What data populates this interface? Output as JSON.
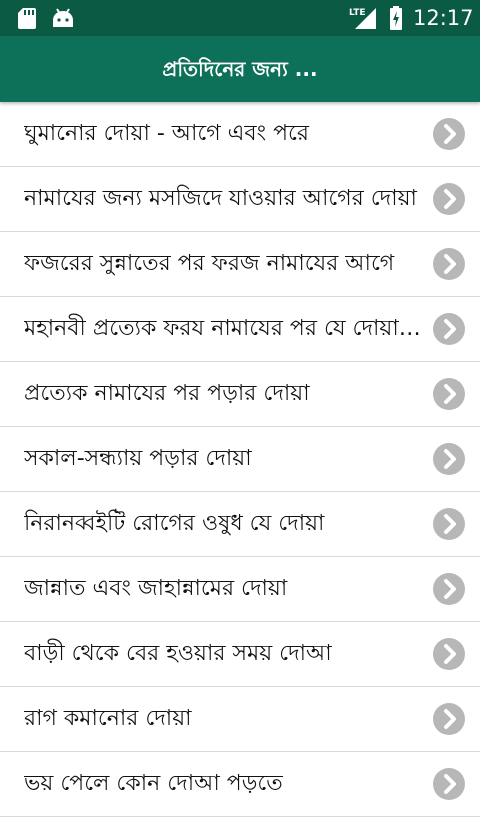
{
  "status_bar": {
    "network": "LTE",
    "time": "12:17"
  },
  "app_bar": {
    "title": "প্রতিদিনের জন্য ..."
  },
  "list": {
    "items": [
      {
        "label": "ঘুমানোর দোয়া - আগে এবং পরে"
      },
      {
        "label": "নামাযের জন্য মসজিদে যাওয়ার আগের দোয়া"
      },
      {
        "label": "ফজরের সুন্নাতের পর ফরজ নামাযের আগে"
      },
      {
        "label": "মহানবী প্রত্যেক ফরয নামাযের পর যে দোয়া পড়তেন"
      },
      {
        "label": "প্রত্যেক নামাযের পর পড়ার দোয়া"
      },
      {
        "label": "সকাল-সন্ধ্যায় পড়ার দোয়া"
      },
      {
        "label": "নিরানব্বইটি রোগের ওষুধ যে দোয়া"
      },
      {
        "label": "জান্নাত এবং জাহান্নামের দোয়া"
      },
      {
        "label": "বাড়ী থেকে বের হওয়ার সময় দোআ"
      },
      {
        "label": "রাগ কমানোর দোয়া"
      },
      {
        "label": "ভয় পেলে কোন দোআ পড়তে"
      }
    ]
  },
  "colors": {
    "status_bar": "#0a5a44",
    "app_bar": "#0d7059",
    "chevron": "#b7b7b7"
  },
  "icons": [
    "sd-card-icon",
    "android-icon",
    "lte-signal-icon",
    "battery-charging-icon",
    "chevron-right-icon"
  ]
}
